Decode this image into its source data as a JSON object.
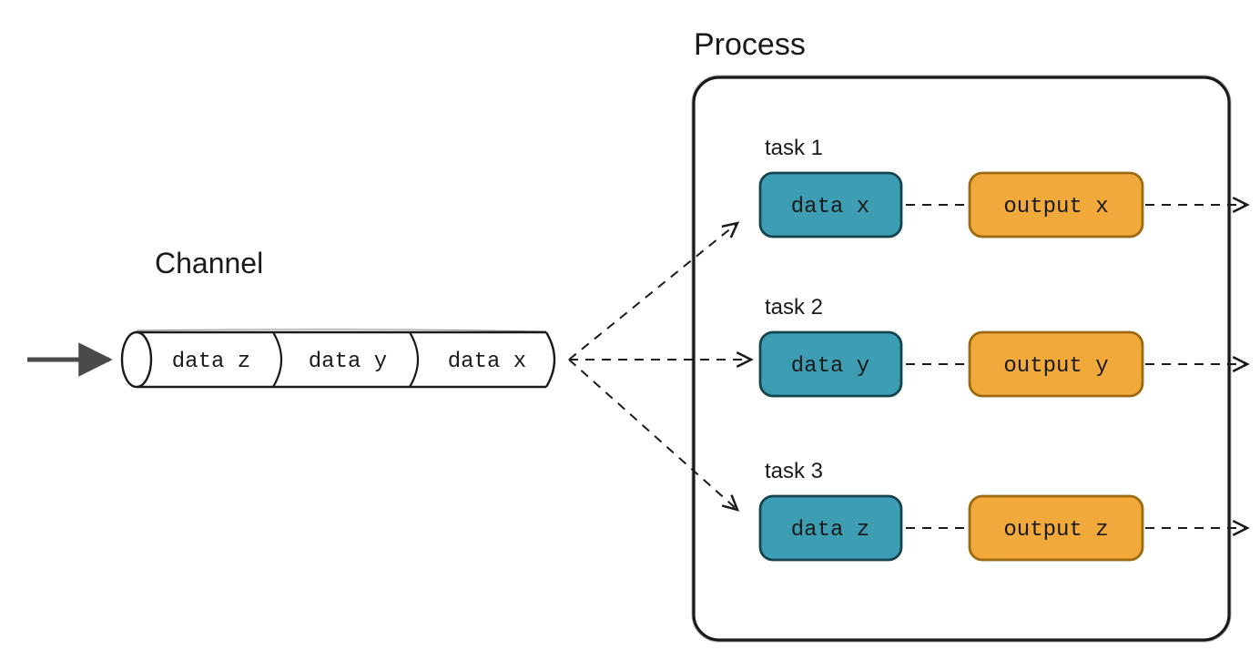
{
  "channel": {
    "label": "Channel",
    "items": [
      "data z",
      "data y",
      "data x"
    ]
  },
  "process": {
    "label": "Process",
    "tasks": [
      {
        "label": "task 1",
        "data": "data x",
        "output": "output x"
      },
      {
        "label": "task 2",
        "data": "data y",
        "output": "output y"
      },
      {
        "label": "task 3",
        "data": "data z",
        "output": "output z"
      }
    ]
  },
  "colors": {
    "stroke": "#1a1a1a",
    "data_fill": "#3d9db3",
    "output_fill": "#f1a93b",
    "box_stroke": "#0d4a5a",
    "output_stroke": "#b77a17"
  }
}
